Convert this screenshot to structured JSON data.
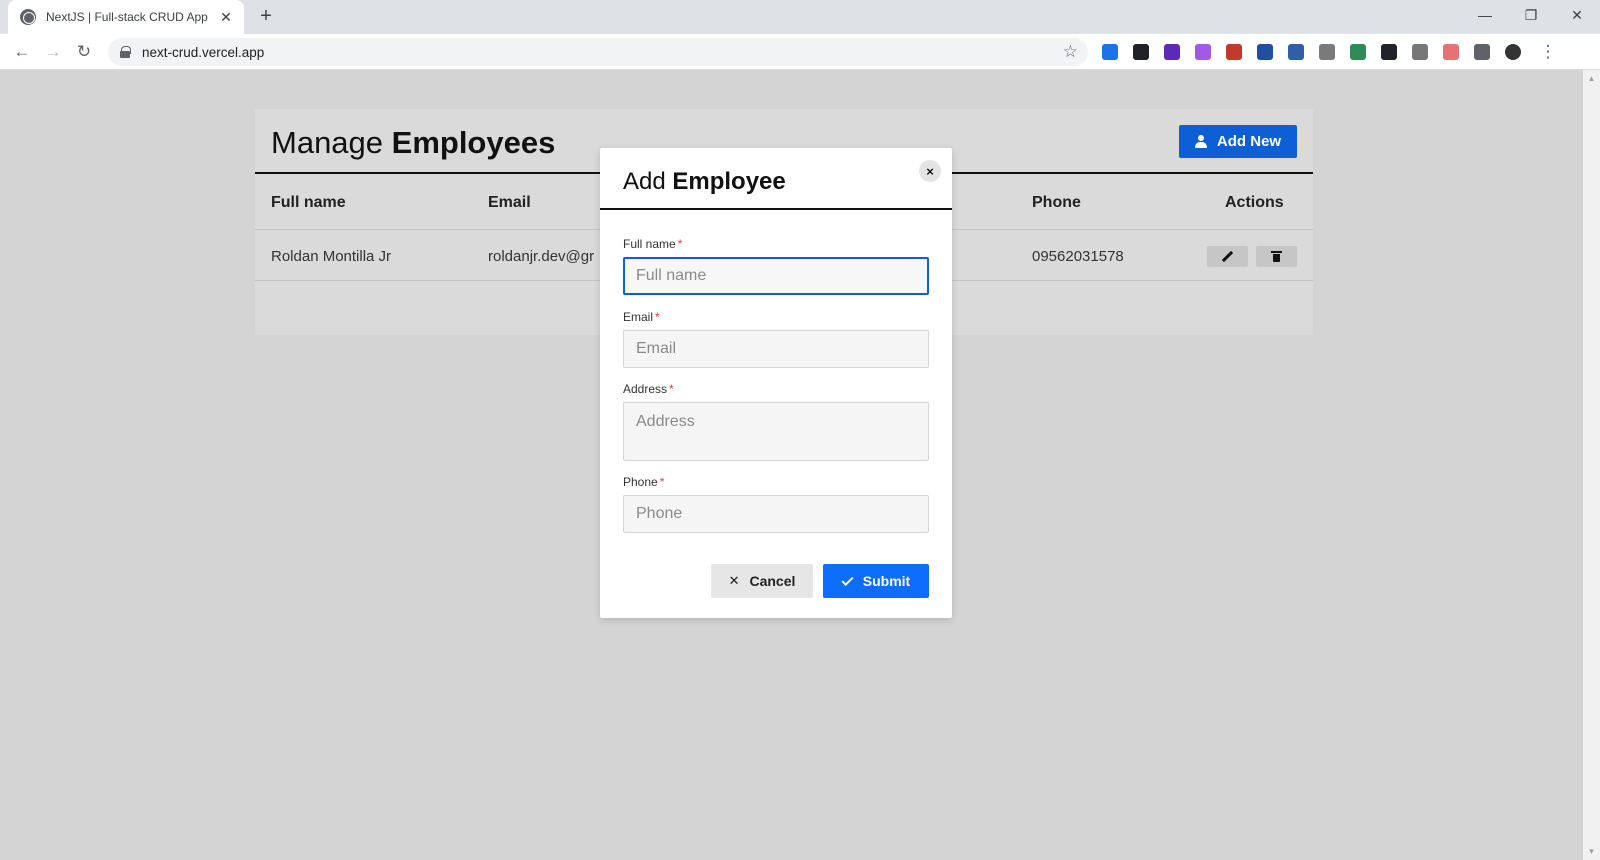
{
  "browser": {
    "tab_title": "NextJS | Full-stack CRUD App",
    "tab_close": "✕",
    "new_tab": "+",
    "url": "next-crud.vercel.app",
    "window_controls": {
      "minimize": "—",
      "restore": "❐",
      "close": "✕"
    },
    "nav": {
      "back": "←",
      "forward": "→",
      "reload": "↻"
    },
    "star": "☆",
    "extensions": [
      {
        "name": "devtools-extension-icon",
        "color": "#1a73e8"
      },
      {
        "name": "font-extension-icon",
        "color": "#202124"
      },
      {
        "name": "purple-extension-icon",
        "color": "#5b2bb8"
      },
      {
        "name": "feather-extension-icon",
        "color": "#a259e6"
      },
      {
        "name": "desc-extension-icon",
        "color": "#c0392b"
      },
      {
        "name": "heart-extension-icon",
        "color": "#1e4fa0"
      },
      {
        "name": "oc-extension-icon",
        "color": "#2f5fa7"
      },
      {
        "name": "camera-extension-icon",
        "color": "#7a7a7a"
      },
      {
        "name": "s-extension-icon",
        "color": "#2e8b57"
      },
      {
        "name": "react-extension-icon",
        "color": "#20232a"
      },
      {
        "name": "eyedropper-extension-icon",
        "color": "#777777"
      },
      {
        "name": "notes-extension-icon",
        "color": "#e57373"
      },
      {
        "name": "puzzle-extension-icon",
        "color": "#5f6368"
      },
      {
        "name": "profile-avatar-icon",
        "color": "#333333"
      }
    ],
    "menu": "⋮"
  },
  "page": {
    "title_light": "Manage ",
    "title_bold": "Employees",
    "add_new_label": "Add New",
    "columns": [
      "Full name",
      "Email",
      "Phone",
      "Actions"
    ],
    "rows": [
      {
        "full_name": "Roldan Montilla Jr",
        "email": "roldanjr.dev@gr",
        "phone": "09562031578"
      }
    ]
  },
  "modal": {
    "title_light": "Add ",
    "title_bold": "Employee",
    "close": "×",
    "required_mark": "*",
    "fields": {
      "full_name": {
        "label": "Full name",
        "placeholder": "Full name",
        "value": ""
      },
      "email": {
        "label": "Email",
        "placeholder": "Email",
        "value": ""
      },
      "address": {
        "label": "Address",
        "placeholder": "Address",
        "value": ""
      },
      "phone": {
        "label": "Phone",
        "placeholder": "Phone",
        "value": ""
      }
    },
    "cancel_label": "Cancel",
    "cancel_icon": "✕",
    "submit_label": "Submit"
  },
  "colors": {
    "primary": "#0d6efd",
    "overlay_bg": "#d4d4d4",
    "required": "#e53935"
  }
}
